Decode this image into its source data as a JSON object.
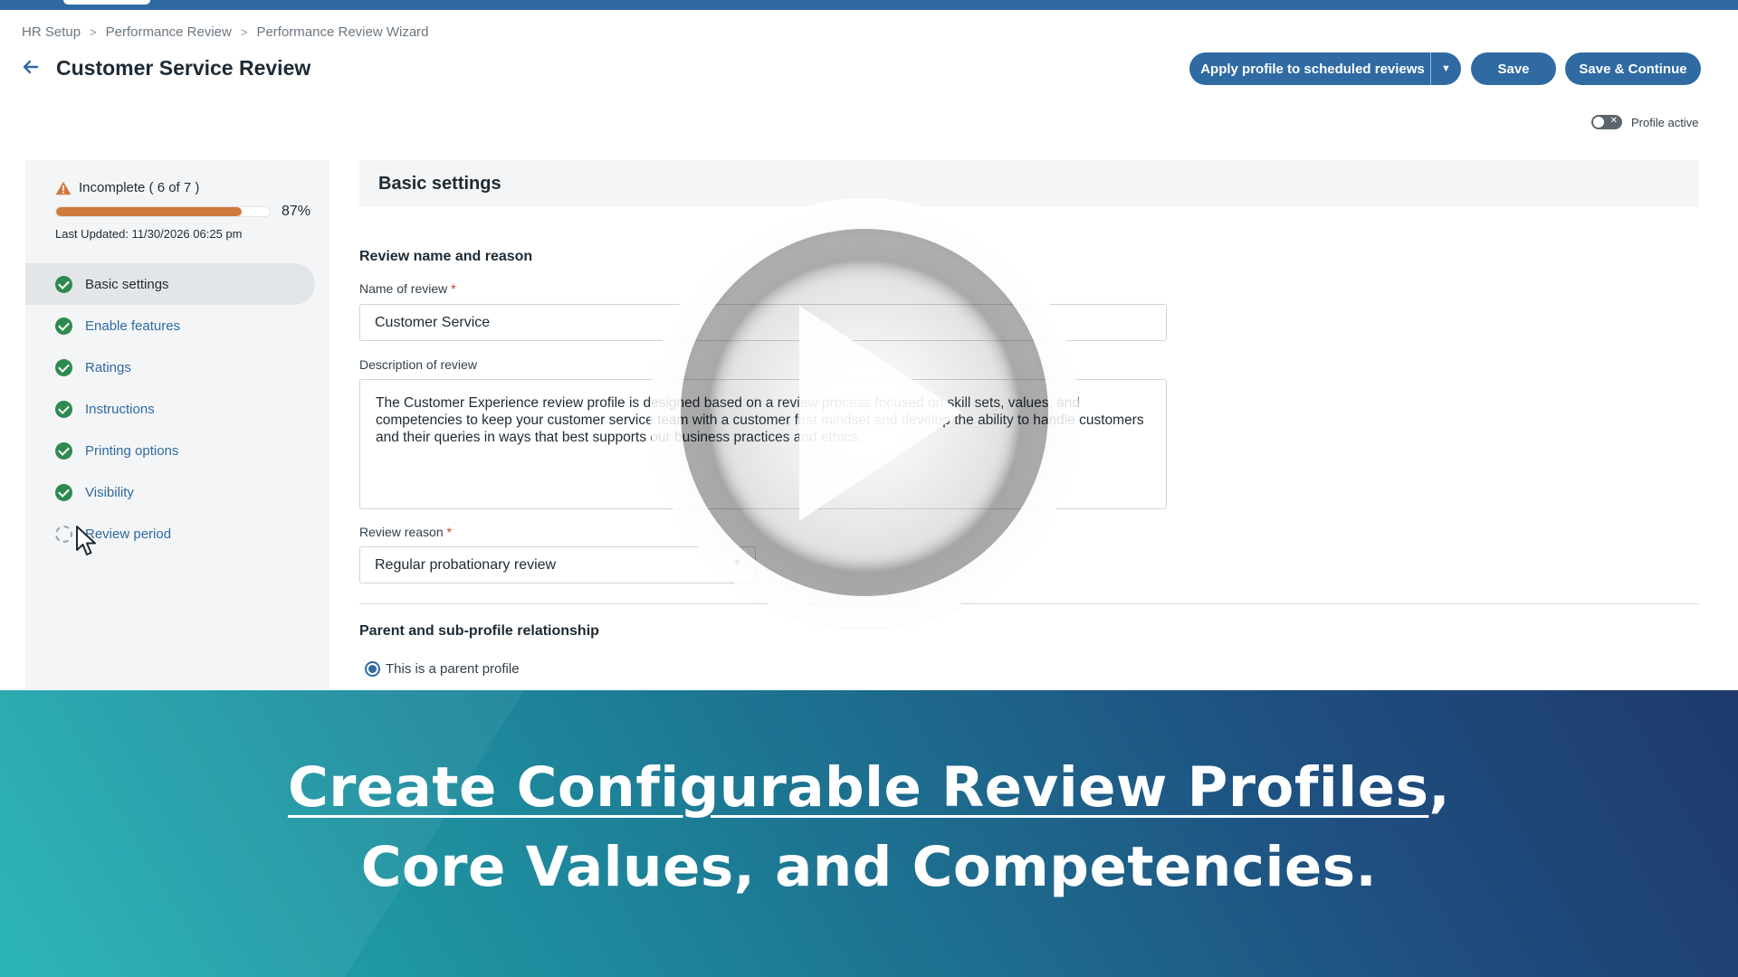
{
  "breadcrumb": [
    "HR Setup",
    "Performance Review",
    "Performance Review Wizard"
  ],
  "page_title": "Customer Service Review",
  "toolbar": {
    "apply_label": "Apply profile to scheduled reviews",
    "save_label": "Save",
    "continue_label": "Save & Continue"
  },
  "profile_toggle": {
    "label": "Profile active",
    "active": false
  },
  "progress": {
    "status": "Incomplete ( 6 of 7 )",
    "percent_label": "87%",
    "percent": 87,
    "last_updated": "Last Updated: 11/30/2026 06:25 pm"
  },
  "nav": [
    {
      "label": "Basic settings",
      "state": "complete",
      "active": true
    },
    {
      "label": "Enable features",
      "state": "complete"
    },
    {
      "label": "Ratings",
      "state": "complete"
    },
    {
      "label": "Instructions",
      "state": "complete"
    },
    {
      "label": "Printing options",
      "state": "complete"
    },
    {
      "label": "Visibility",
      "state": "complete"
    },
    {
      "label": "Review period",
      "state": "pending"
    }
  ],
  "main": {
    "section_header": "Basic settings",
    "name_reason_title": "Review name and reason",
    "name_label": "Name of review",
    "name_value": "Customer Service",
    "desc_label": "Description of review",
    "desc_value": "The Customer Experience review profile is designed based on a review process focused on skill sets, values, and competencies to keep your customer service team with a customer first mindset and develop the ability to handle customers and their queries in ways that best supports our business practices and ethics.",
    "reason_label": "Review reason",
    "reason_value": "Regular probationary review",
    "required_mark": "*",
    "relationship_title": "Parent and sub-profile relationship",
    "parent_option": "This is a parent profile"
  },
  "banner": {
    "line1_underlined": "Create Configurable Review Profiles",
    "line1_suffix": ",",
    "line2": "Core Values, and Competencies."
  },
  "colors": {
    "accent": "#2f6aa3",
    "progress": "#cf7a3e",
    "complete": "#2e8a4e"
  }
}
